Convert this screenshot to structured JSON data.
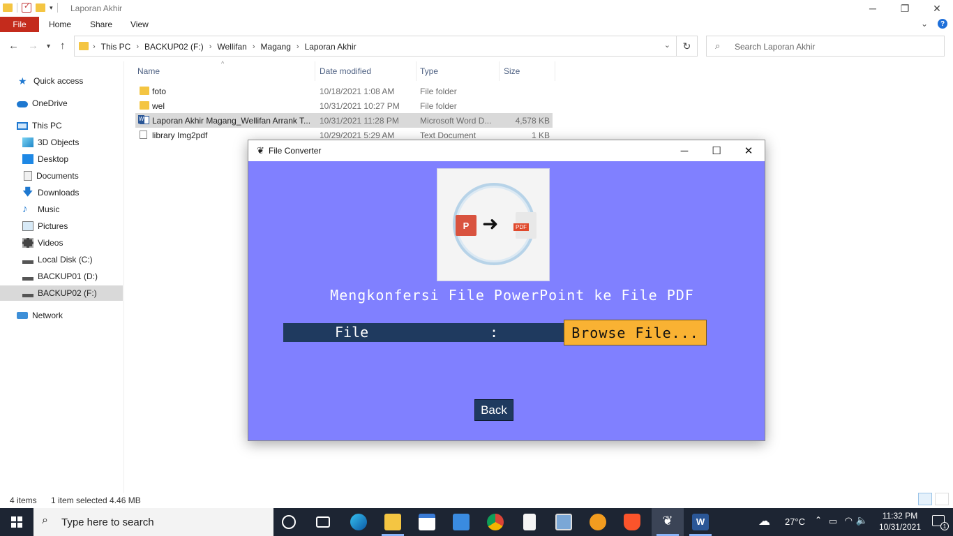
{
  "explorer": {
    "window_title": "Laporan Akhir",
    "ribbon": {
      "file": "File",
      "home": "Home",
      "share": "Share",
      "view": "View"
    },
    "breadcrumbs": [
      "This PC",
      "BACKUP02 (F:)",
      "Wellifan",
      "Magang",
      "Laporan Akhir"
    ],
    "search_placeholder": "Search Laporan Akhir",
    "nav_items": [
      {
        "label": "Quick access",
        "icon": "star-icon"
      },
      {
        "label": "OneDrive",
        "icon": "cloud-icon"
      },
      {
        "label": "This PC",
        "icon": "pc-icon"
      },
      {
        "label": "3D Objects",
        "icon": "cube-icon"
      },
      {
        "label": "Desktop",
        "icon": "desktop-icon"
      },
      {
        "label": "Documents",
        "icon": "documents-icon"
      },
      {
        "label": "Downloads",
        "icon": "download-icon"
      },
      {
        "label": "Music",
        "icon": "music-icon"
      },
      {
        "label": "Pictures",
        "icon": "pictures-icon"
      },
      {
        "label": "Videos",
        "icon": "videos-icon"
      },
      {
        "label": "Local Disk (C:)",
        "icon": "drive-icon"
      },
      {
        "label": "BACKUP01 (D:)",
        "icon": "drive-icon"
      },
      {
        "label": "BACKUP02 (F:)",
        "icon": "drive-icon",
        "selected": true
      },
      {
        "label": "Network",
        "icon": "network-icon"
      }
    ],
    "columns": {
      "name": "Name",
      "date": "Date modified",
      "type": "Type",
      "size": "Size"
    },
    "files": [
      {
        "name": "foto",
        "date": "10/18/2021 1:08 AM",
        "type": "File folder",
        "size": "",
        "icon": "folder-icon"
      },
      {
        "name": "wel",
        "date": "10/31/2021 10:27 PM",
        "type": "File folder",
        "size": "",
        "icon": "folder-icon"
      },
      {
        "name": "Laporan Akhir Magang_Wellifan Arrank T...",
        "date": "10/31/2021 11:28 PM",
        "type": "Microsoft Word D...",
        "size": "4,578 KB",
        "icon": "word-document-icon",
        "selected": true
      },
      {
        "name": "library Img2pdf",
        "date": "10/29/2021 5:29 AM",
        "type": "Text Document",
        "size": "1 KB",
        "icon": "text-document-icon"
      }
    ],
    "status": {
      "items": "4 items",
      "selected": "1 item selected  4.46 MB"
    }
  },
  "dialog": {
    "title": "File Converter",
    "heading": "Mengkonfersi File PowerPoint ke File PDF",
    "file_label": "File",
    "file_colon": ":",
    "browse_button": "Browse File...",
    "back_button": "Back",
    "logo": {
      "pdf_label": "PDF",
      "ppt_label": "P"
    },
    "colors": {
      "background": "#8080ff",
      "bar": "#1f3a5f",
      "browse": "#f9b233"
    }
  },
  "taskbar": {
    "search_placeholder": "Type here to search",
    "weather": "27°C",
    "time": "11:32 PM",
    "date": "10/31/2021",
    "notification_count": "1"
  }
}
